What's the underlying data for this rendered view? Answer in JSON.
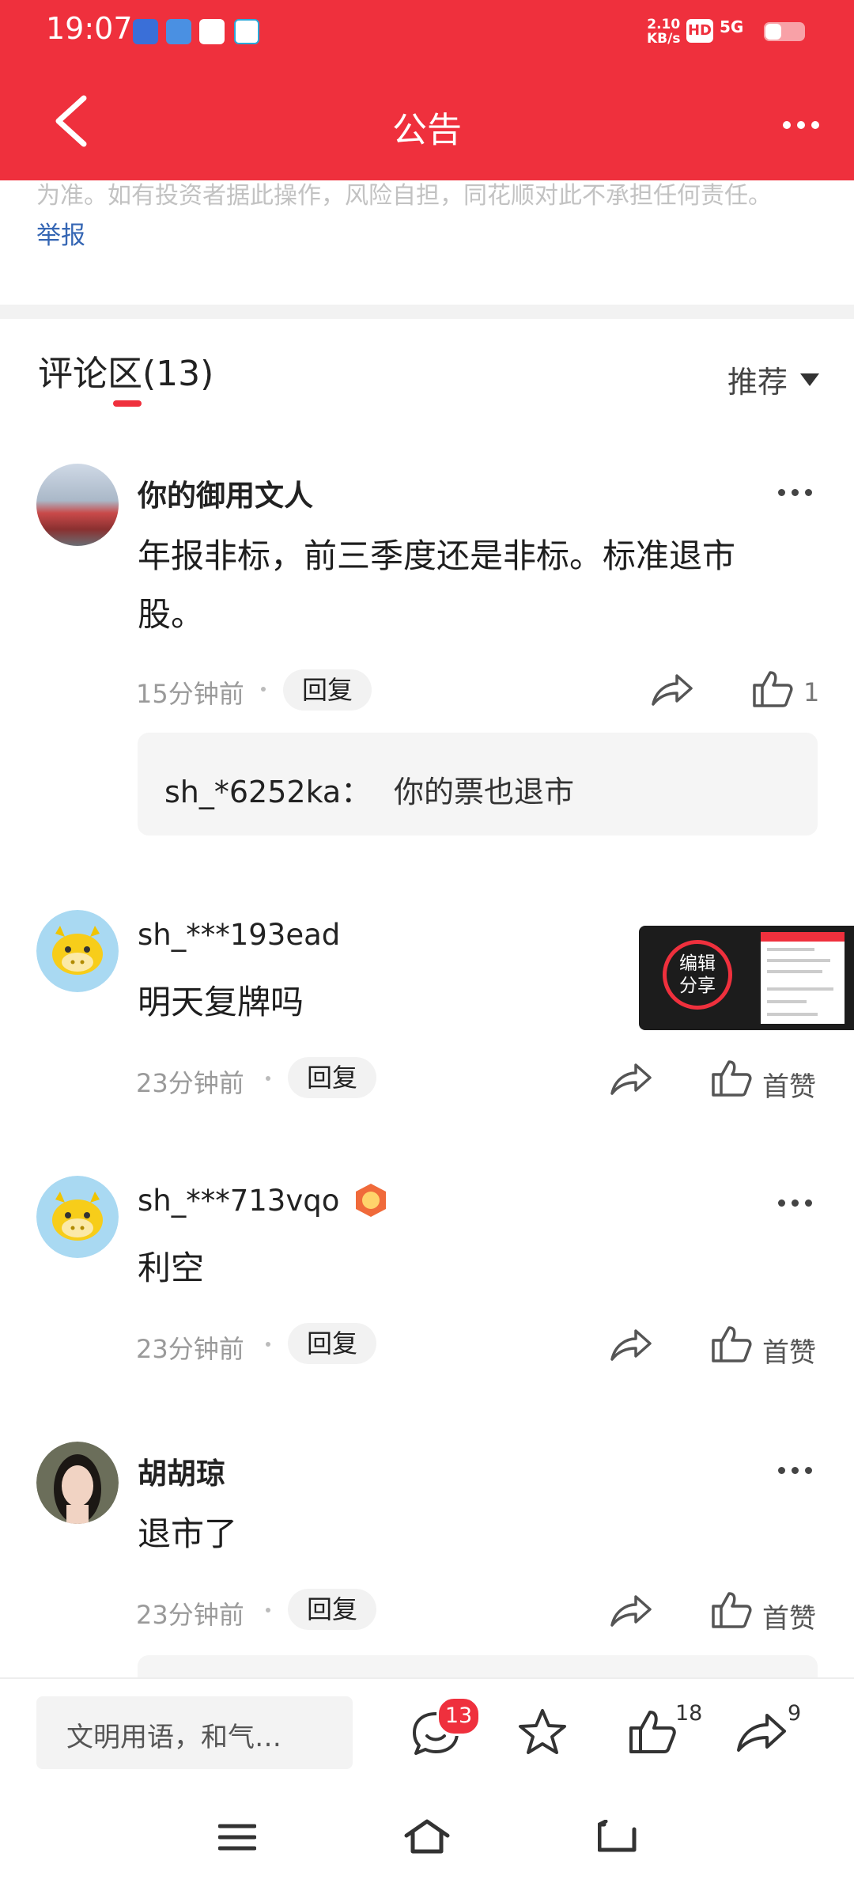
{
  "status_bar": {
    "time": "19:07",
    "net_speed_value": "2.10",
    "net_speed_unit": "KB/s",
    "hd": "HD",
    "network": "5G"
  },
  "header": {
    "title": "公告"
  },
  "disclaimer": {
    "text": "为准。如有投资者据此操作，风险自担，同花顺对此不承担任何责任。",
    "report": "举报"
  },
  "comments_section": {
    "title": "评论区(13)",
    "sort_label": "推荐"
  },
  "comments": [
    {
      "username": "你的御用文人",
      "text_line1": "年报非标，前三季度还是非标。标准退市",
      "text_line2": "股。",
      "time": "15分钟前",
      "reply": "回复",
      "likes": "1",
      "reply_preview": {
        "user": "sh_*6252ka：",
        "text": "你的票也退市"
      }
    },
    {
      "username": "sh_***193ead",
      "text": "明天复牌吗",
      "time": "23分钟前",
      "reply": "回复",
      "like_label": "首赞"
    },
    {
      "username": "sh_***713vqo",
      "text": "利空",
      "time": "23分钟前",
      "reply": "回复",
      "like_label": "首赞"
    },
    {
      "username": "胡胡琼",
      "text": "退市了",
      "time": "23分钟前",
      "reply": "回复",
      "like_label": "首赞"
    }
  ],
  "float_widget": {
    "line1": "编辑",
    "line2": "分享"
  },
  "bottom_bar": {
    "input_placeholder": "文明用语，和气…",
    "comment_count": "13",
    "like_count": "18",
    "share_count": "9"
  },
  "colors": {
    "brand_red": "#ef303d",
    "link_blue": "#3566b4"
  },
  "icons": [
    "back-arrow-icon",
    "more-icon",
    "share-arrow-icon",
    "thumb-up-icon",
    "comment-icon",
    "star-icon",
    "menu-icon",
    "home-icon",
    "return-icon"
  ]
}
